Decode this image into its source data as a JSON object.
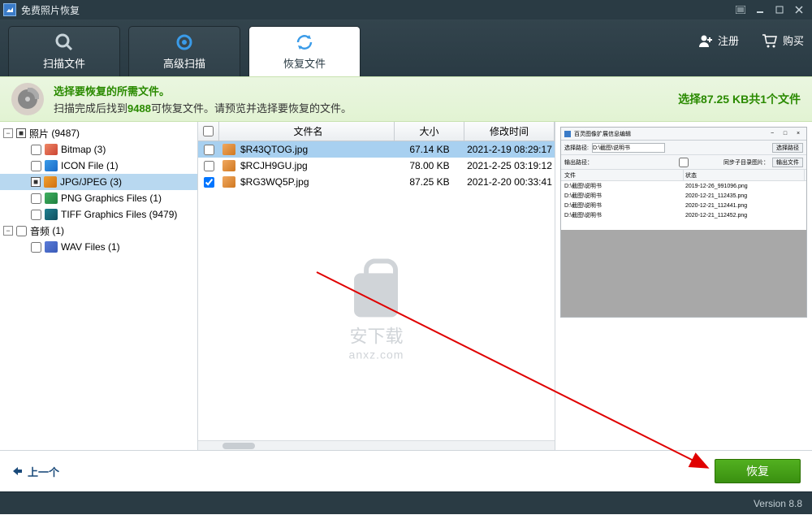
{
  "title": "免费照片恢复",
  "tabs": {
    "scan": "扫描文件",
    "adv": "高级扫描",
    "recover": "恢复文件"
  },
  "topbtn": {
    "register": "注册",
    "buy": "购买"
  },
  "info": {
    "line1": "选择要恢复的所需文件。",
    "line2a": "扫描完成后找到",
    "count": "9488",
    "line2b": "可恢复文件。请预览并选择要恢复的文件。",
    "selected": "选择87.25 KB共1个文件"
  },
  "tree": {
    "photo": {
      "label": "照片",
      "count": "(9487)"
    },
    "items": [
      {
        "label": "Bitmap",
        "count": "(3)",
        "icon": "bmp"
      },
      {
        "label": "ICON File",
        "count": "(1)",
        "icon": "ico"
      },
      {
        "label": "JPG/JPEG",
        "count": "(3)",
        "icon": "jpg",
        "selected": true,
        "mixed": true
      },
      {
        "label": "PNG Graphics Files",
        "count": "(1)",
        "icon": "png"
      },
      {
        "label": "TIFF Graphics Files",
        "count": "(9479)",
        "icon": "tif"
      }
    ],
    "audio": {
      "label": "音频",
      "count": "(1)"
    },
    "audioitems": [
      {
        "label": "WAV Files",
        "count": "(1)",
        "icon": "wav"
      }
    ]
  },
  "cols": {
    "name": "文件名",
    "size": "大小",
    "date": "修改时间"
  },
  "files": [
    {
      "name": "$R43QTOG.jpg",
      "size": "67.14 KB",
      "date": "2021-2-19 08:29:17",
      "selected": true,
      "checked": false
    },
    {
      "name": "$RCJH9GU.jpg",
      "size": "78.00 KB",
      "date": "2021-2-25 03:19:12",
      "checked": false
    },
    {
      "name": "$RG3WQ5P.jpg",
      "size": "87.25 KB",
      "date": "2021-2-20 00:33:41",
      "checked": true
    }
  ],
  "watermark": {
    "text": "安下载",
    "sub": "anxz.com"
  },
  "preview": {
    "title": "百灵图像扩展信息编辑",
    "label1": "选择路径:",
    "path": "D:\\截图\\说明书",
    "btn1": "选择路径",
    "label2": "输出路径：",
    "cb": "同步子目录图片：",
    "btn2": "输出文件",
    "col1": "文件",
    "col2": "状态",
    "rows": [
      {
        "a": "D:\\截图\\说明书",
        "b": "2019-12-26_991096.png"
      },
      {
        "a": "D:\\截图\\说明书",
        "b": "2020-12-21_112435.png"
      },
      {
        "a": "D:\\截图\\说明书",
        "b": "2020-12-21_112441.png"
      },
      {
        "a": "D:\\截图\\说明书",
        "b": "2020-12-21_112452.png"
      }
    ]
  },
  "footer": {
    "back": "上一个",
    "recover": "恢复"
  },
  "version": "Version 8.8"
}
